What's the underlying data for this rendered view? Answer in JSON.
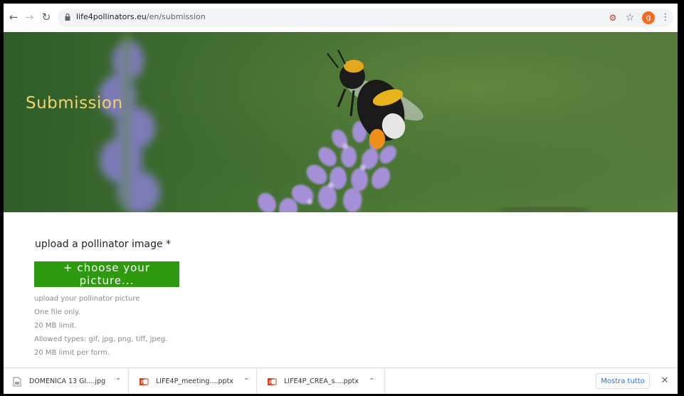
{
  "browser": {
    "url_domain": "life4pollinators.eu",
    "url_path": "/en/submission",
    "profile_initial": "g"
  },
  "hero": {
    "title": "Submission"
  },
  "form": {
    "upload_label": "upload a pollinator image *",
    "choose_button": "+ choose your picture...",
    "help_lines": [
      "upload your pollinator picture",
      "One file only.",
      "20 MB limit.",
      "Allowed types: gif, jpg, png, tiff, jpeg.",
      "20 MB limit per form."
    ]
  },
  "downloads": {
    "items": [
      {
        "name": "DOMENICA 13 GI....jpg",
        "icon": "image-file-icon"
      },
      {
        "name": "LIFE4P_meeting....pptx",
        "icon": "powerpoint-icon"
      },
      {
        "name": "LIFE4P_CREA_s....pptx",
        "icon": "powerpoint-icon"
      }
    ],
    "show_all_label": "Mostra tutto"
  },
  "colors": {
    "hero_title": "#f0d46a",
    "button_bg": "#2e9a10",
    "show_all": "#1a73e8",
    "profile": "#f56a1f"
  }
}
